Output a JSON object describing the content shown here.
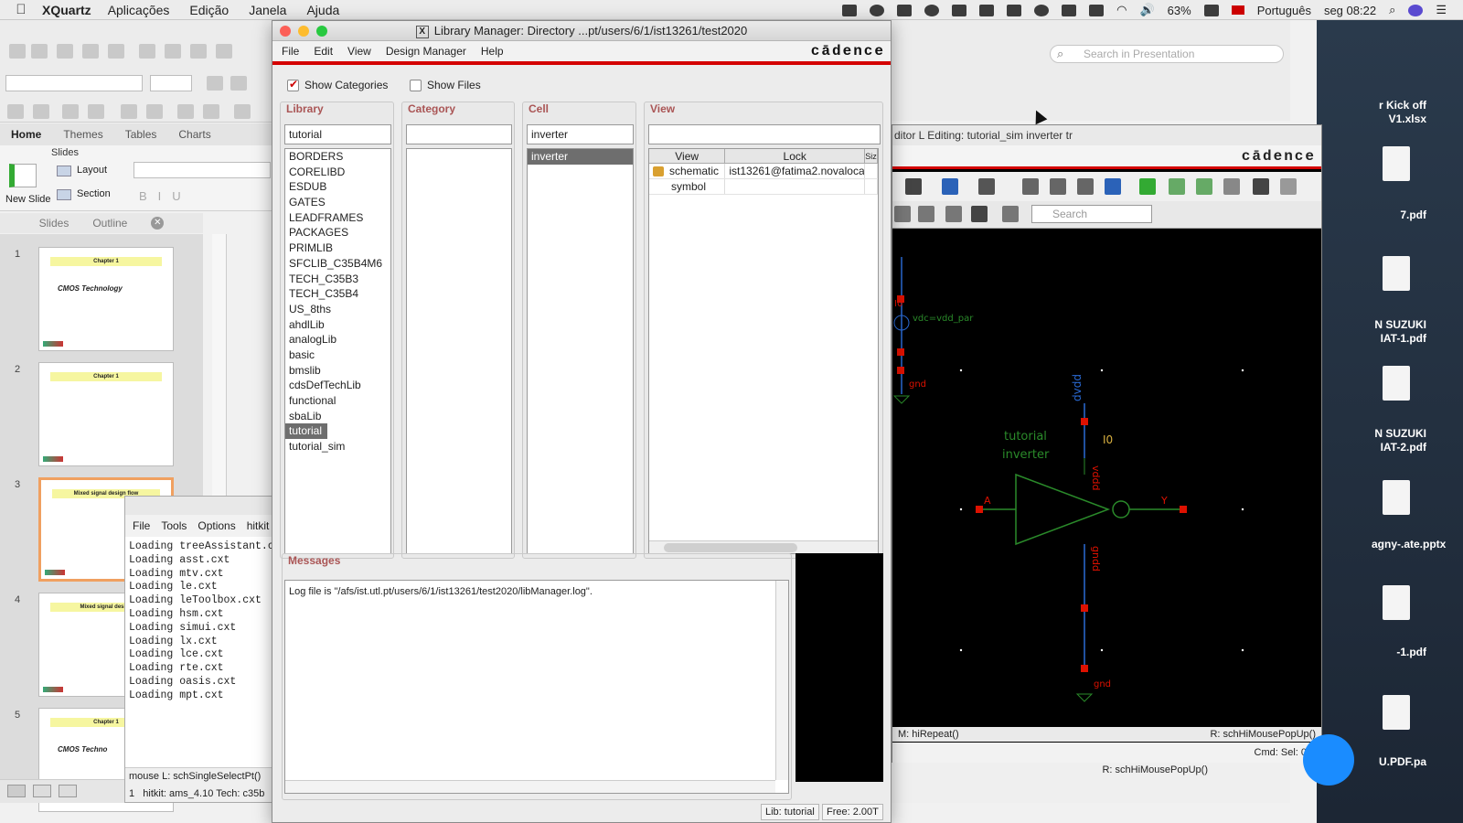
{
  "menubar": {
    "app": "XQuartz",
    "items": [
      "Aplicações",
      "Edição",
      "Janela",
      "Ajuda"
    ],
    "battery": "63%",
    "language": "Português",
    "clock": "seg 08:22"
  },
  "ppt": {
    "tabs": [
      "Home",
      "Themes",
      "Tables",
      "Charts"
    ],
    "ribbon": {
      "slides_label": "Slides",
      "new_slide": "New Slide",
      "layout": "Layout",
      "section": "Section"
    },
    "pane_tabs": [
      "Slides",
      "Outline"
    ],
    "search_placeholder": "Search in Presentation",
    "slides": [
      {
        "num": "1",
        "band": "Chapter 1",
        "title": "CMOS Technology"
      },
      {
        "num": "2",
        "band": "Chapter 1",
        "title": ""
      },
      {
        "num": "3",
        "band": "Mixed signal design flow",
        "title": ""
      },
      {
        "num": "4",
        "band": "Mixed signal design",
        "title": ""
      },
      {
        "num": "5",
        "band": "Chapter 1",
        "title": "CMOS Techno"
      }
    ]
  },
  "terminal": {
    "menu": [
      "File",
      "Tools",
      "Options",
      "hitkit"
    ],
    "lines": [
      "Loading treeAssistant.cxt",
      "Loading asst.cxt",
      "Loading mtv.cxt",
      "Loading le.cxt",
      "Loading leToolbox.cxt",
      "Loading hsm.cxt",
      "Loading simui.cxt",
      "Loading lx.cxt",
      "Loading lce.cxt",
      "Loading rte.cxt",
      "Loading oasis.cxt",
      "Loading mpt.cxt"
    ],
    "status_mouse": "mouse L: schSingleSelectPt()",
    "status_num": "1",
    "status_tech": "hitkit: ams_4.10  Tech: c35b"
  },
  "libmgr": {
    "title": "Library Manager: Directory ...pt/users/6/1/ist13261/test2020",
    "menu": [
      "File",
      "Edit",
      "View",
      "Design Manager",
      "Help"
    ],
    "brand": "cādence",
    "show_categories": "Show Categories",
    "show_files": "Show Files",
    "library": {
      "title": "Library",
      "filter": "tutorial",
      "items": [
        "BORDERS",
        "CORELIBD",
        "ESDUB",
        "GATES",
        "LEADFRAMES",
        "PACKAGES",
        "PRIMLIB",
        "SFCLIB_C35B4M6",
        "TECH_C35B3",
        "TECH_C35B4",
        "US_8ths",
        "ahdlLib",
        "analogLib",
        "basic",
        "bmslib",
        "cdsDefTechLib",
        "functional",
        "sbaLib",
        "tutorial",
        "tutorial_sim"
      ],
      "selected": "tutorial"
    },
    "category": {
      "title": "Category",
      "filter": ""
    },
    "cell": {
      "title": "Cell",
      "filter": "inverter",
      "items": [
        "inverter"
      ],
      "selected": "inverter"
    },
    "view": {
      "title": "View",
      "filter": "",
      "columns": [
        "View",
        "Lock",
        "Siz"
      ],
      "rows": [
        {
          "view": "schematic",
          "lock": "ist13261@fatima2.novalocal"
        },
        {
          "view": "symbol",
          "lock": ""
        }
      ]
    },
    "messages": {
      "title": "Messages",
      "text": "Log file is \"/afs/ist.utl.pt/users/6/1/ist13261/test2020/libManager.log\"."
    },
    "status_lib": "Lib: tutorial",
    "status_free": "Free: 2.00T"
  },
  "sch": {
    "title": "ditor L Editing: tutorial_sim inverter tr",
    "brand": "cādence",
    "search_placeholder": "Search",
    "status_left": "M: hiRepeat()",
    "status_right": "R: schHiMousePopUp()",
    "cmd": "Cmd: Sel: 0",
    "bottom_status": "R: schHiMousePopUp()",
    "labels": {
      "vdd_src": "vdc=vdd_par",
      "gnd": "gnd",
      "vdd_pin": "dvdd",
      "instance": "I0",
      "lib": "tutorial",
      "cell": "inverter",
      "in": "A",
      "out": "Y",
      "vddd": "vddd",
      "gndd": "gndd",
      "i0_top": "I0"
    }
  },
  "desktop": {
    "files": [
      "r Kick off V1.xlsx",
      "7.pdf",
      "N SUZUKI IAT-1.pdf",
      "N SUZUKI IAT-2.pdf",
      "agny-.ate.pptx",
      "-1.pdf",
      "U.PDF.pa"
    ]
  }
}
